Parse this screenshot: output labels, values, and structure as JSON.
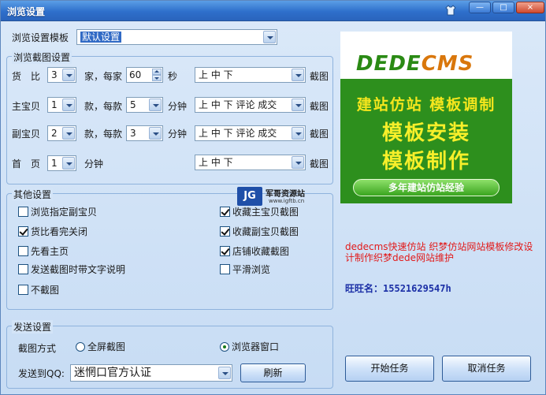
{
  "window": {
    "title": "浏览设置",
    "controls": {
      "minimize": "—",
      "maximize": "□",
      "close": "×"
    }
  },
  "template": {
    "label": "浏览设置模板",
    "value": "默认设置"
  },
  "screenshot_group": {
    "title": "浏览截图设置",
    "rows": [
      {
        "label": "货　比",
        "count": "3",
        "unit": "家，每家",
        "amount": "60",
        "amount_unit": "秒",
        "order": "上  中  下",
        "shot": "截图"
      },
      {
        "label": "主宝贝",
        "count": "1",
        "unit": "款，每款",
        "amount": "5",
        "amount_unit": "分钟",
        "order": "上  中  下  评论  成交",
        "shot": "截图"
      },
      {
        "label": "副宝贝",
        "count": "2",
        "unit": "款，每款",
        "amount": "3",
        "amount_unit": "分钟",
        "order": "上  中  下  评论  成交",
        "shot": "截图"
      },
      {
        "label": "首　页",
        "count": "1",
        "unit": "分钟",
        "order": "上  中  下",
        "shot": "截图"
      }
    ]
  },
  "other_group": {
    "title": "其他设置",
    "left": [
      {
        "label": "浏览指定副宝贝",
        "checked": false
      },
      {
        "label": "货比看完关闭",
        "checked": true
      },
      {
        "label": "先看主页",
        "checked": false
      },
      {
        "label": "发送截图时带文字说明",
        "checked": false
      },
      {
        "label": "不截图",
        "checked": false
      }
    ],
    "right": [
      {
        "label": "收藏主宝贝截图",
        "checked": true
      },
      {
        "label": "收藏副宝贝截图",
        "checked": true
      },
      {
        "label": "店铺收藏截图",
        "checked": true
      },
      {
        "label": "平滑浏览",
        "checked": false
      }
    ]
  },
  "send_group": {
    "title": "发送设置",
    "mode_label": "截图方式",
    "mode_full": "全屏截图",
    "mode_window": "浏览器窗口",
    "mode_selected": "window",
    "qq_label": "发送到QQ:",
    "qq_value": "迷惘口官方认证",
    "refresh": "刷新"
  },
  "banner": {
    "logo_left": "DEDE",
    "logo_right": "CMS",
    "line1": "建站仿站  模板调制",
    "line2": "模板安装",
    "line3": "模板制作",
    "pill": "多年建站仿站经验"
  },
  "watermark": {
    "badge": "JG",
    "name": "军哥资源站",
    "site": "www.igftb.cn"
  },
  "promo_text": "dedecms快速仿站 织梦仿站网站模板修改设计制作织梦dede网站维护",
  "wang_label": "旺旺名：",
  "wang_value": "15521629547h",
  "actions": {
    "start": "开始任务",
    "cancel": "取消任务"
  }
}
